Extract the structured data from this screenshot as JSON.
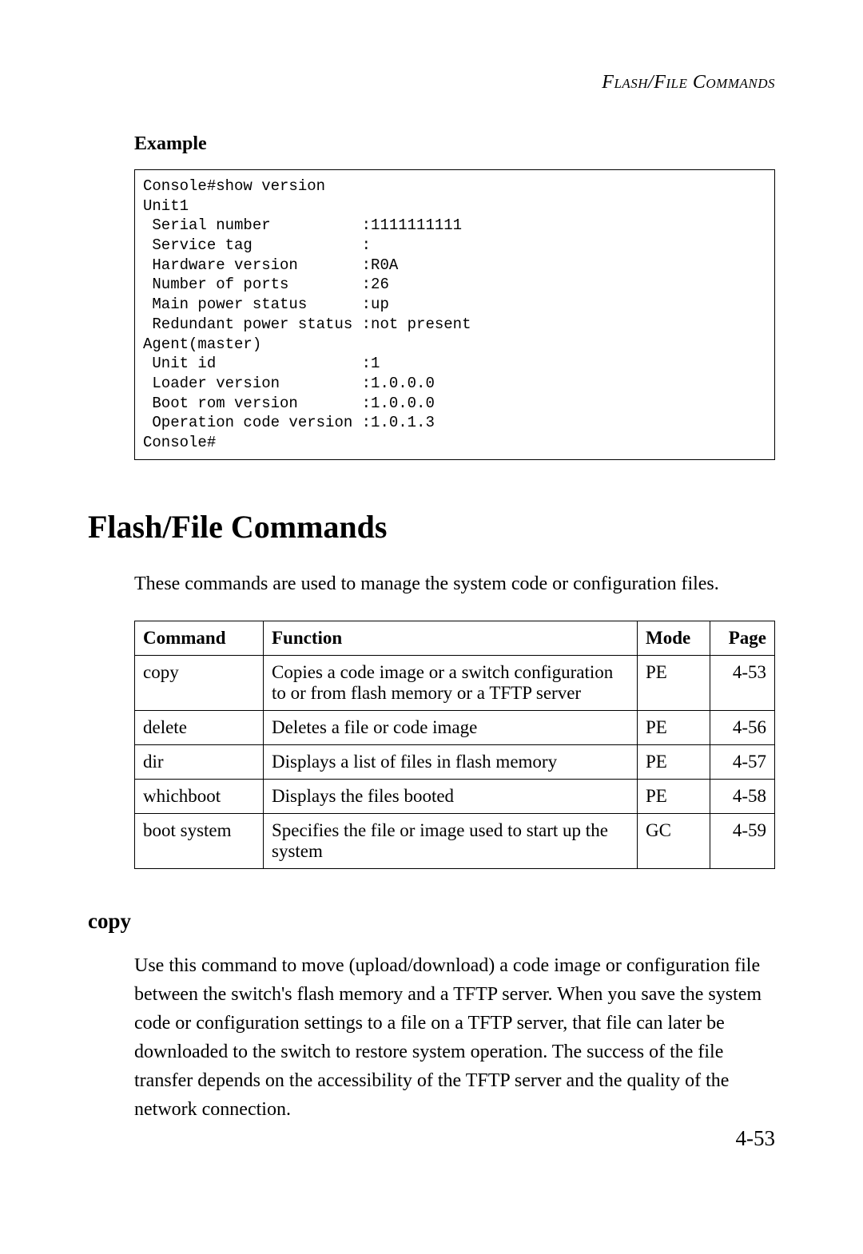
{
  "runningHead": "Flash/File Commands",
  "exampleHeading": "Example",
  "codeLines": [
    "Console#show version",
    "Unit1",
    " Serial number          :1111111111",
    " Service tag            :",
    " Hardware version       :R0A",
    " Number of ports        :26",
    " Main power status      :up",
    " Redundant power status :not present",
    "Agent(master)",
    " Unit id                :1",
    " Loader version         :1.0.0.0",
    " Boot rom version       :1.0.0.0",
    " Operation code version :1.0.1.3",
    "Console#"
  ],
  "sectionTitle": "Flash/File Commands",
  "sectionIntro": "These commands are used to manage the system code or configuration files.",
  "table": {
    "headers": {
      "command": "Command",
      "function": "Function",
      "mode": "Mode",
      "page": "Page"
    },
    "rows": [
      {
        "command": "copy",
        "function": "Copies a code image or a switch configuration to or from flash memory or a TFTP server",
        "mode": "PE",
        "page": "4-53"
      },
      {
        "command": "delete",
        "function": "Deletes a file or code image",
        "mode": "PE",
        "page": "4-56"
      },
      {
        "command": "dir",
        "function": "Displays a list of files in flash memory",
        "mode": "PE",
        "page": "4-57"
      },
      {
        "command": "whichboot",
        "function": "Displays the files booted",
        "mode": "PE",
        "page": "4-58"
      },
      {
        "command": "boot system",
        "function": "Specifies the file or image used to start up the system",
        "mode": "GC",
        "page": "4-59"
      }
    ]
  },
  "copy": {
    "heading": "copy",
    "body": "Use this command to move (upload/download) a code image or configuration file between the switch's flash memory and a TFTP server. When you save the system code or configuration settings to a file on a TFTP server, that file can later be downloaded to the switch to restore system operation. The success of the file transfer depends on the accessibility of the TFTP server and the quality of the network connection."
  },
  "pageNumber": "4-53"
}
